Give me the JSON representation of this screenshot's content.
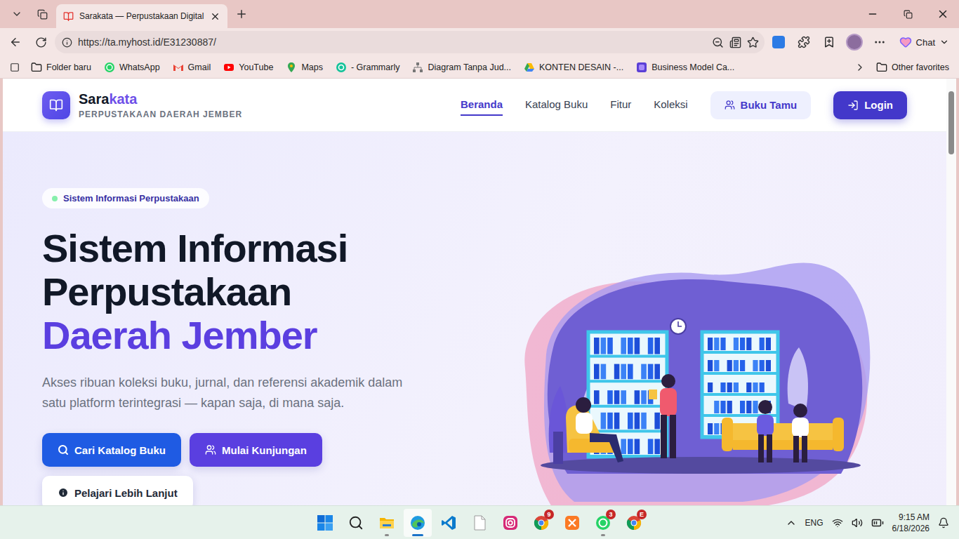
{
  "browser": {
    "tab": {
      "title": "Sarakata — Perpustakaan Digital",
      "selected": true
    },
    "url": "https://ta.myhost.id/E31230887/",
    "chat_label": "Chat",
    "bookmarks": [
      {
        "label": "Folder baru",
        "kind": "folder"
      },
      {
        "label": "WhatsApp",
        "kind": "whatsapp"
      },
      {
        "label": "Gmail",
        "kind": "gmail"
      },
      {
        "label": "YouTube",
        "kind": "youtube"
      },
      {
        "label": "Maps",
        "kind": "maps"
      },
      {
        "label": "- Grammarly",
        "kind": "grammarly"
      },
      {
        "label": "Diagram Tanpa Jud...",
        "kind": "diagram"
      },
      {
        "label": "KONTEN DESAIN -...",
        "kind": "drive"
      },
      {
        "label": "Business Model Ca...",
        "kind": "canva"
      }
    ],
    "other_favorites": "Other favorites"
  },
  "site": {
    "brand": {
      "first": "Sara",
      "second": "kata",
      "subtitle": "PERPUSTAKAAN DAERAH JEMBER"
    },
    "nav": [
      {
        "label": "Beranda",
        "selected": true
      },
      {
        "label": "Katalog Buku",
        "selected": false
      },
      {
        "label": "Fitur",
        "selected": false
      },
      {
        "label": "Koleksi",
        "selected": false
      }
    ],
    "guest_button": "Buku Tamu",
    "login_button": "Login"
  },
  "hero": {
    "badge": "Sistem Informasi Perpustakaan",
    "title_lines": [
      "Sistem Informasi",
      "Perpustakaan"
    ],
    "highlight": "Daerah Jember",
    "description": "Akses ribuan koleksi buku, jurnal, dan referensi akademik dalam satu platform terintegrasi — kapan saja, di mana saja.",
    "buttons": [
      {
        "label": "Cari Katalog Buku",
        "kind": "primary"
      },
      {
        "label": "Mulai Kunjungan",
        "kind": "secondary"
      },
      {
        "label": "Pelajari Lebih Lanjut",
        "kind": "outline"
      }
    ]
  },
  "taskbar": {
    "apps": [
      {
        "kind": "start",
        "running": false,
        "selected": false
      },
      {
        "kind": "search",
        "running": false,
        "selected": false
      },
      {
        "kind": "explorer",
        "running": true,
        "selected": false
      },
      {
        "kind": "edge",
        "running": true,
        "selected": true
      },
      {
        "kind": "vscode",
        "running": false,
        "selected": false
      },
      {
        "kind": "file",
        "running": false,
        "selected": false
      },
      {
        "kind": "instagram",
        "running": false,
        "selected": false
      },
      {
        "kind": "chrome",
        "running": false,
        "selected": false,
        "badge": "9"
      },
      {
        "kind": "xampp",
        "running": false,
        "selected": false
      },
      {
        "kind": "whatsapp",
        "running": true,
        "selected": false,
        "badge": "3"
      },
      {
        "kind": "chrome",
        "running": false,
        "selected": false,
        "badge": "E"
      }
    ],
    "language": "ENG",
    "time": "9:15 AM",
    "date": "6/18/2026"
  }
}
